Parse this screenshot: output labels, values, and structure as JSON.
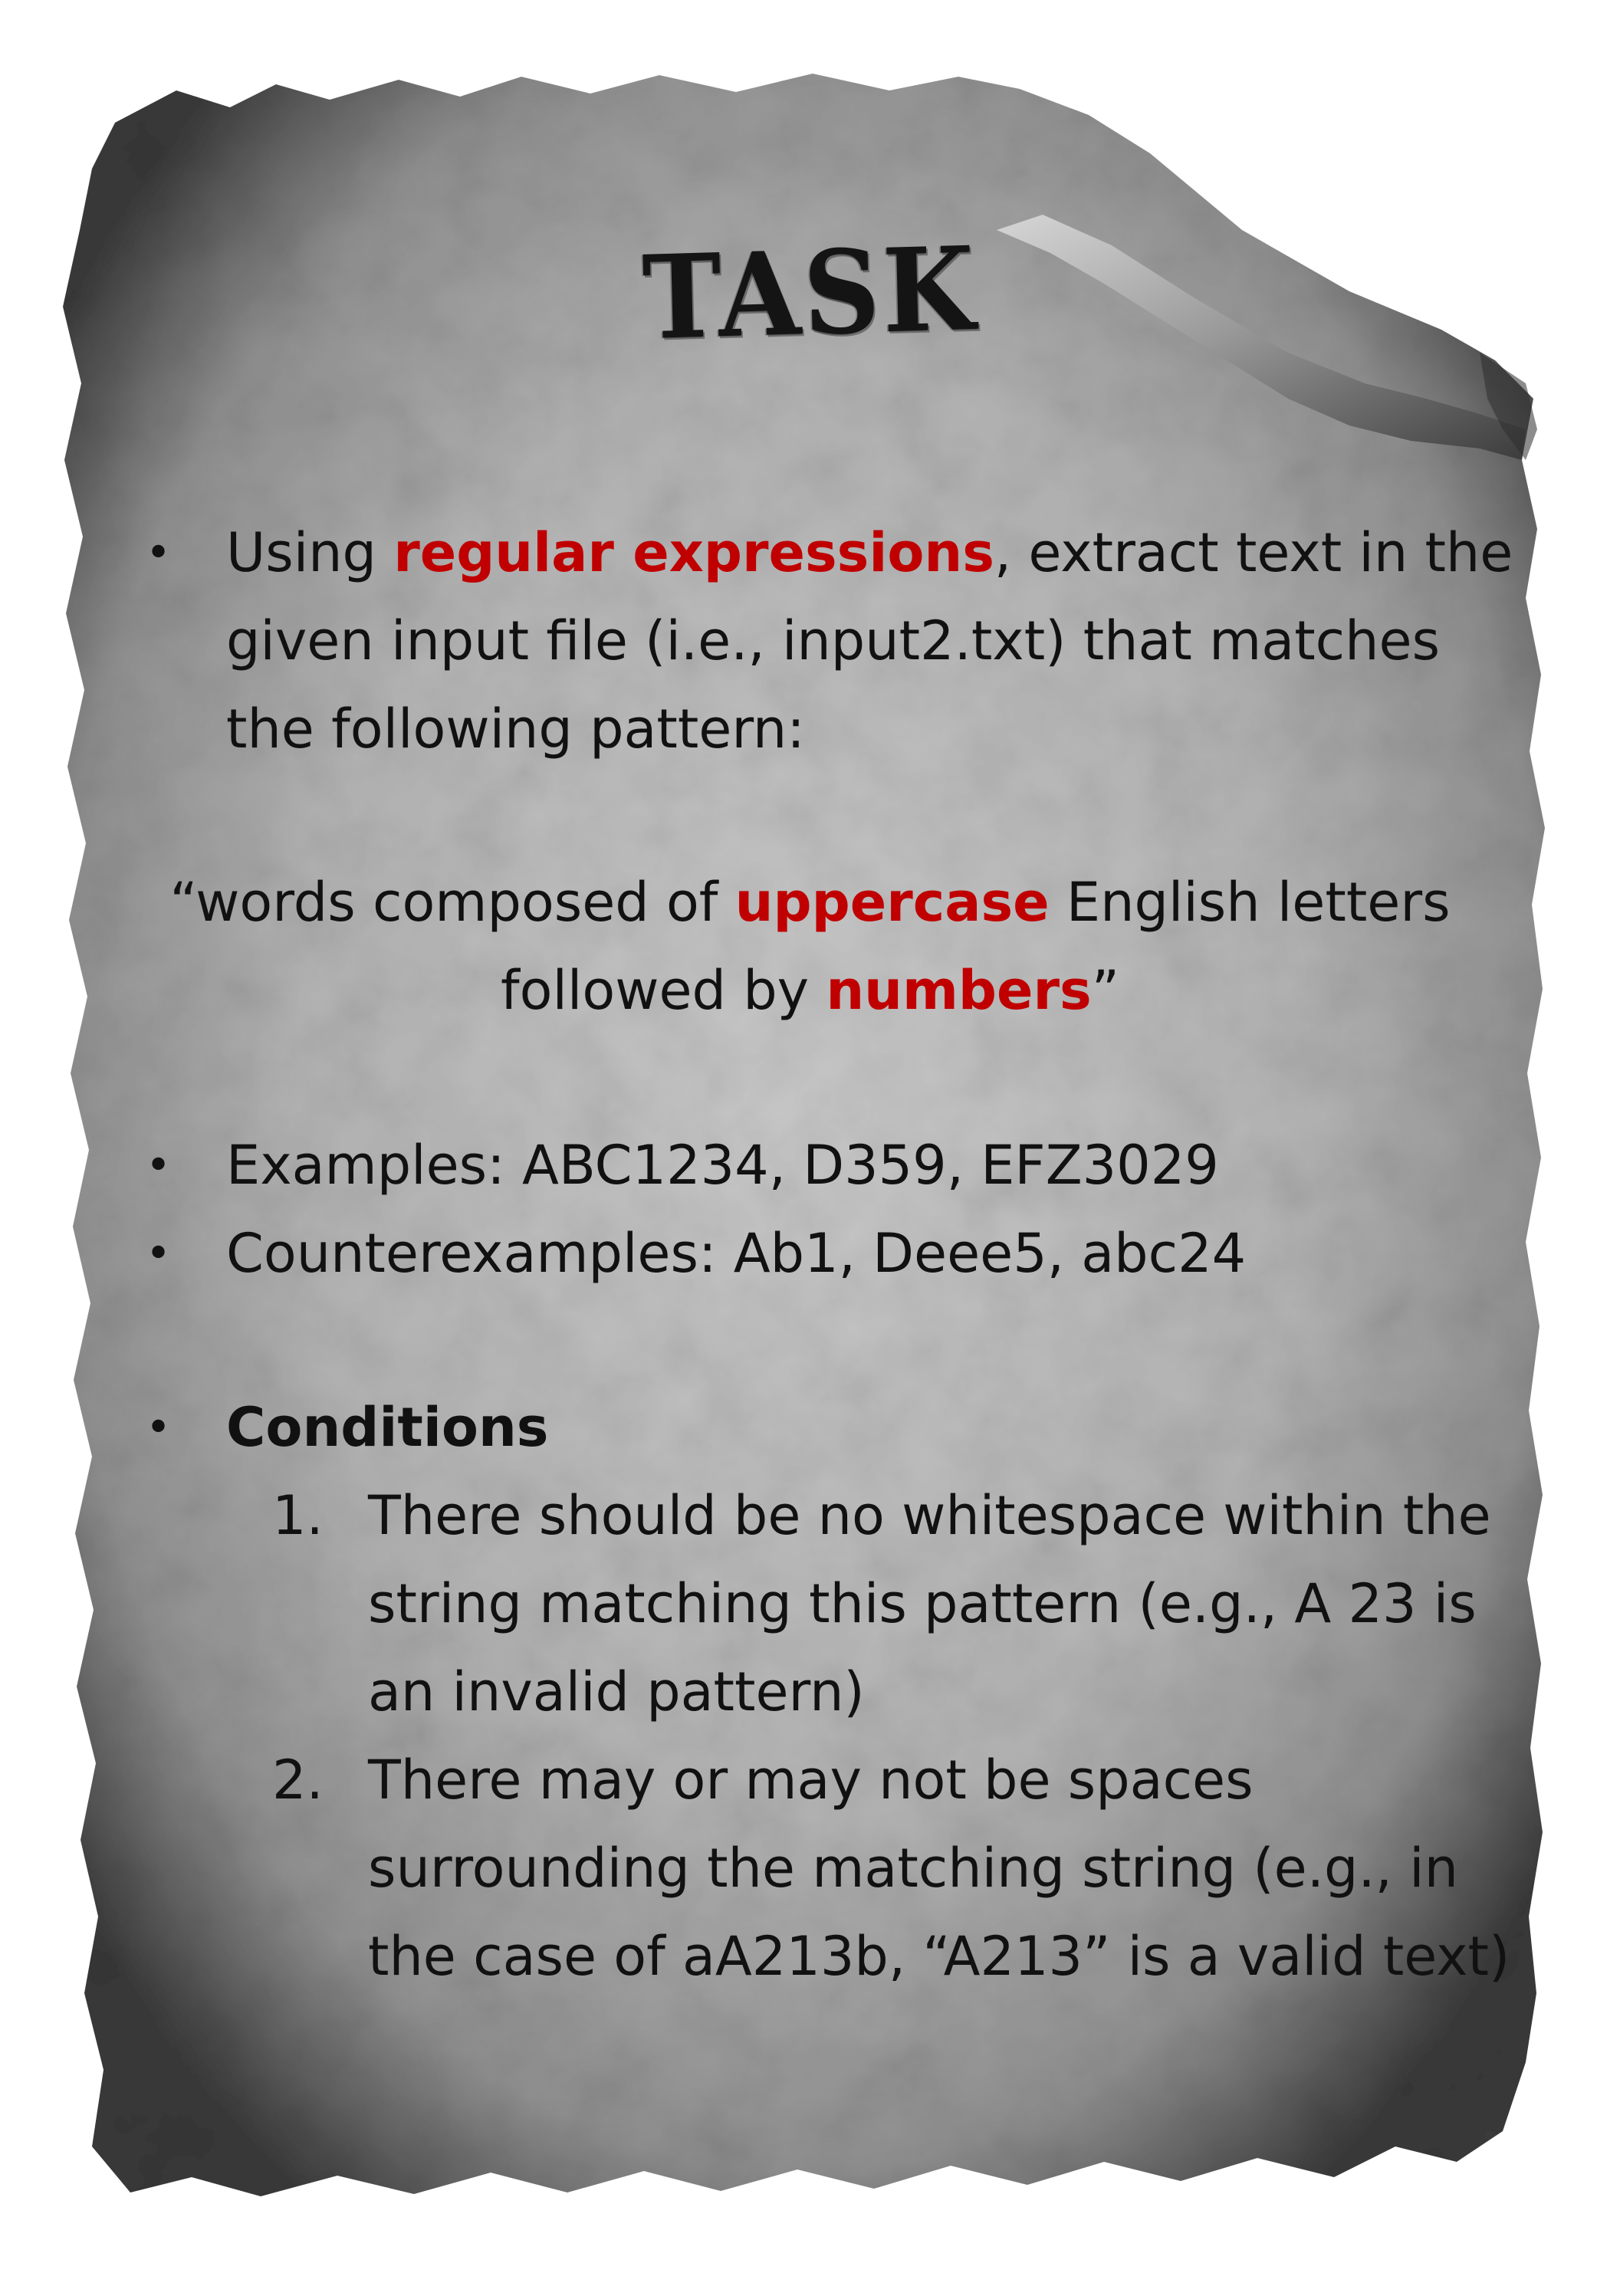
{
  "title": "TASK",
  "bullet1": {
    "bullet": "•",
    "line1_before": "Using ",
    "line1_highlight": "regular expressions",
    "line1_after": ", extract text in the",
    "line2": "given input file (i.e., input2.txt) that matches",
    "line3": "the following pattern:"
  },
  "pattern": {
    "line1_before": "“words composed of ",
    "line1_highlight": "uppercase",
    "line1_after": " English letters",
    "line2_before": "followed by ",
    "line2_highlight": "numbers",
    "line2_after": "”"
  },
  "examples": {
    "bullet": "•",
    "text": "Examples: ABC1234, D359, EFZ3029"
  },
  "counterexamples": {
    "bullet": "•",
    "text": "Counterexamples: Ab1, Deee5, abc24"
  },
  "conditions": {
    "bullet": "•",
    "heading": "Conditions",
    "items": [
      {
        "number": "1.",
        "lines": [
          "There should be no whitespace within the",
          "string matching this pattern (e.g., A 23 is",
          "an invalid pattern)"
        ]
      },
      {
        "number": "2.",
        "lines": [
          "There may or may not be spaces",
          "surrounding the matching string (e.g., in",
          "the case of aA213b, “A213” is a valid text)"
        ]
      }
    ]
  },
  "colors": {
    "highlight": "#c00000",
    "paper": "#a9a9a9",
    "ink": "#111111"
  }
}
